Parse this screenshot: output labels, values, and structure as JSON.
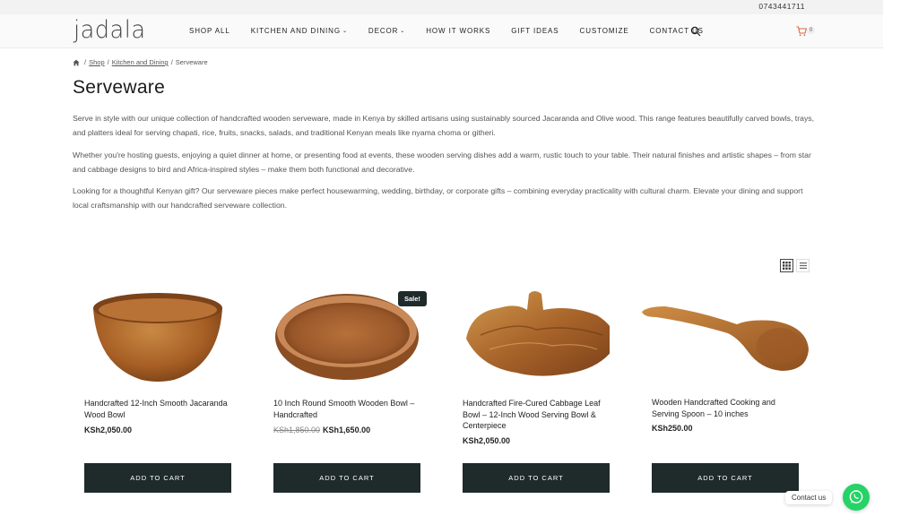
{
  "topbar": {
    "phone": "0743441711"
  },
  "header": {
    "logo": "jadala",
    "nav": [
      {
        "label": "SHOP ALL",
        "dropdown": false
      },
      {
        "label": "KITCHEN AND DINING",
        "dropdown": true
      },
      {
        "label": "DECOR",
        "dropdown": true
      },
      {
        "label": "HOW IT WORKS",
        "dropdown": false
      },
      {
        "label": "GIFT IDEAS",
        "dropdown": false
      },
      {
        "label": "CUSTOMIZE",
        "dropdown": false
      },
      {
        "label": "CONTACT US",
        "dropdown": false
      }
    ],
    "cart_count": "0"
  },
  "breadcrumb": {
    "shop": "Shop",
    "category": "Kitchen and Dining",
    "current": "Serveware",
    "separator": "/"
  },
  "page": {
    "title": "Serveware",
    "desc1": "Serve in style with our unique collection of handcrafted wooden serveware, made in Kenya by skilled artisans using sustainably sourced Jacaranda and Olive wood. This range features beautifully carved bowls, trays, and platters ideal for serving chapati, rice, fruits, snacks, salads, and traditional Kenyan meals like nyama choma or githeri.",
    "desc2": "Whether you're hosting guests, enjoying a quiet dinner at home, or presenting food at events, these wooden serving dishes add a warm, rustic touch to your table. Their natural finishes and artistic shapes – from star and cabbage designs to bird and Africa-inspired styles – make them both functional and decorative.",
    "desc3": "Looking for a thoughtful Kenyan gift? Our serveware pieces make perfect housewarming, wedding, birthday, or corporate gifts – combining everyday practicality with cultural charm. Elevate your dining and support local craftsmanship with our handcrafted serveware collection."
  },
  "products": [
    {
      "name": "Handcrafted 12-Inch Smooth Jacaranda Wood Bowl",
      "price": "KSh2,050.00",
      "old_price": "",
      "button": "ADD TO CART"
    },
    {
      "name": "10 Inch Round Smooth Wooden Bowl – Handcrafted",
      "price": "KSh1,650.00",
      "old_price": "KSh1,850.00",
      "badge": "Sale!",
      "button": "ADD TO CART"
    },
    {
      "name": "Handcrafted Fire-Cured Cabbage Leaf Bowl – 12-Inch Wood Serving Bowl & Centerpiece",
      "price": "KSh2,050.00",
      "old_price": "",
      "button": "ADD TO CART"
    },
    {
      "name": "Wooden Handcrafted Cooking and Serving Spoon – 10 inches",
      "price": "KSh250.00",
      "old_price": "",
      "button": "ADD TO CART"
    }
  ],
  "contact": {
    "label": "Contact us"
  },
  "colors": {
    "button": "#1f2a2a",
    "whatsapp": "#25d366",
    "wood": "#a8652a"
  }
}
